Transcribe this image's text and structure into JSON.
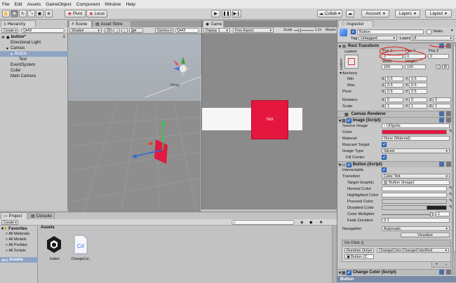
{
  "menubar": [
    "File",
    "Edit",
    "Assets",
    "GameObject",
    "Component",
    "Window",
    "Help"
  ],
  "toolbar": {
    "pivot": "Pivot",
    "local": "Local",
    "collab": "Collab",
    "account": "Account",
    "layers": "Layers",
    "layout": "Layout"
  },
  "hierarchy": {
    "tab": "Hierarchy",
    "create": "Create",
    "search_placeholder": "Q▾All",
    "items": [
      {
        "label": "button*",
        "indent": 0,
        "expanded": true,
        "selected": false
      },
      {
        "label": "Directional Light",
        "indent": 1,
        "expanded": null,
        "selected": false
      },
      {
        "label": "Canvas",
        "indent": 1,
        "expanded": true,
        "selected": false
      },
      {
        "label": "Button",
        "indent": 2,
        "expanded": true,
        "selected": true
      },
      {
        "label": "Text",
        "indent": 3,
        "expanded": null,
        "selected": false
      },
      {
        "label": "EventSystem",
        "indent": 1,
        "expanded": null,
        "selected": false
      },
      {
        "label": "Cube",
        "indent": 1,
        "expanded": null,
        "selected": false
      },
      {
        "label": "Main Camera",
        "indent": 1,
        "expanded": null,
        "selected": false
      }
    ]
  },
  "scene": {
    "tab_scene": "Scene",
    "tab_asset_store": "Asset Store",
    "shaded": "Shaded",
    "mode_2d": "2D",
    "gizmos": "Gizmos",
    "search_placeholder": "Q▾All",
    "gizmo_label": "Persp"
  },
  "game": {
    "tab": "Game",
    "display": "Display 1",
    "aspect": "Free Aspect",
    "scale_label": "Scale",
    "scale_value": "1.1x",
    "maximize": "Maxim",
    "button_text": "TMX"
  },
  "project": {
    "tab_project": "Project",
    "tab_console": "Console",
    "create": "Create",
    "favorites": "Favorites",
    "fav_items": [
      "All Materials",
      "All Models",
      "All Prefabs",
      "All Scripts"
    ],
    "assets_root": "Assets",
    "breadcrumb": "Assets",
    "files": [
      {
        "label": "button",
        "icon": "unity-scene-icon"
      },
      {
        "label": "ChangeCol...",
        "icon": "csharp-script-icon"
      }
    ]
  },
  "inspector": {
    "tab": "Inspector",
    "object_name": "Button",
    "static_label": "Static",
    "tag_label": "Tag",
    "tag_value": "Untagged",
    "layer_label": "Layer",
    "layer_value": "UI",
    "rect_transform": {
      "title": "Rect Transform",
      "anchor_preset": "custom",
      "side_label": "custom",
      "pos_x_label": "Pos X",
      "pos_y_label": "Pos Y",
      "pos_z_label": "Pos Z",
      "pos_x": "0",
      "pos_y": "0",
      "pos_z": "0",
      "width_label": "Width",
      "height_label": "Height",
      "width": "100",
      "height": "100",
      "r_button": "R",
      "anchors_label": "Anchors",
      "min_label": "Min",
      "max_label": "Max",
      "min_x": "0.5",
      "min_y": "0.5",
      "max_x": "0.5",
      "max_y": "0.5",
      "pivot_label": "Pivot",
      "pivot_x": "0.5",
      "pivot_y": "0.5",
      "rotation_label": "Rotation",
      "rot_x": "0",
      "rot_y": "0",
      "rot_z": "0",
      "scale_label": "Scale",
      "scale_x": "1",
      "scale_y": "1",
      "scale_z": "1",
      "x": "X",
      "y": "Y",
      "z": "Z"
    },
    "canvas_renderer": {
      "title": "Canvas Renderer"
    },
    "image": {
      "title": "Image (Script)",
      "source_image_label": "Source Image",
      "source_image": "UISprite",
      "color_label": "Color",
      "color_value": "#e5173f",
      "material_label": "Material",
      "material": "None (Material)",
      "raycast_label": "Raycast Target",
      "image_type_label": "Image Type",
      "image_type": "Sliced",
      "fill_center_label": "Fill Center"
    },
    "button": {
      "title": "Button (Script)",
      "interactable_label": "Interactable",
      "transition_label": "Transition",
      "transition": "Color Tint",
      "target_graphic_label": "Target Graphic",
      "target_graphic": "Button (Image)",
      "normal_label": "Normal Color",
      "highlighted_label": "Highlighted Color",
      "pressed_label": "Pressed Color",
      "disabled_label": "Disabled Color",
      "multiplier_label": "Color Multiplier",
      "multiplier": "1",
      "fade_label": "Fade Duration",
      "fade": "0.1",
      "navigation_label": "Navigation",
      "navigation": "Automatic",
      "visualize": "Visualize",
      "on_click": "On Click ()",
      "runtime": "Runtime Only",
      "function": "ChangeColor.ChangeColorRed",
      "target": "Button (C",
      "plus": "+",
      "minus": "−"
    },
    "change_color": {
      "title": "Change Color (Script)"
    },
    "footer": "Button"
  },
  "colors": {
    "accent_blue": "#3a7ad6",
    "button_red": "#e5173f",
    "annotation_red": "#e0201c"
  }
}
